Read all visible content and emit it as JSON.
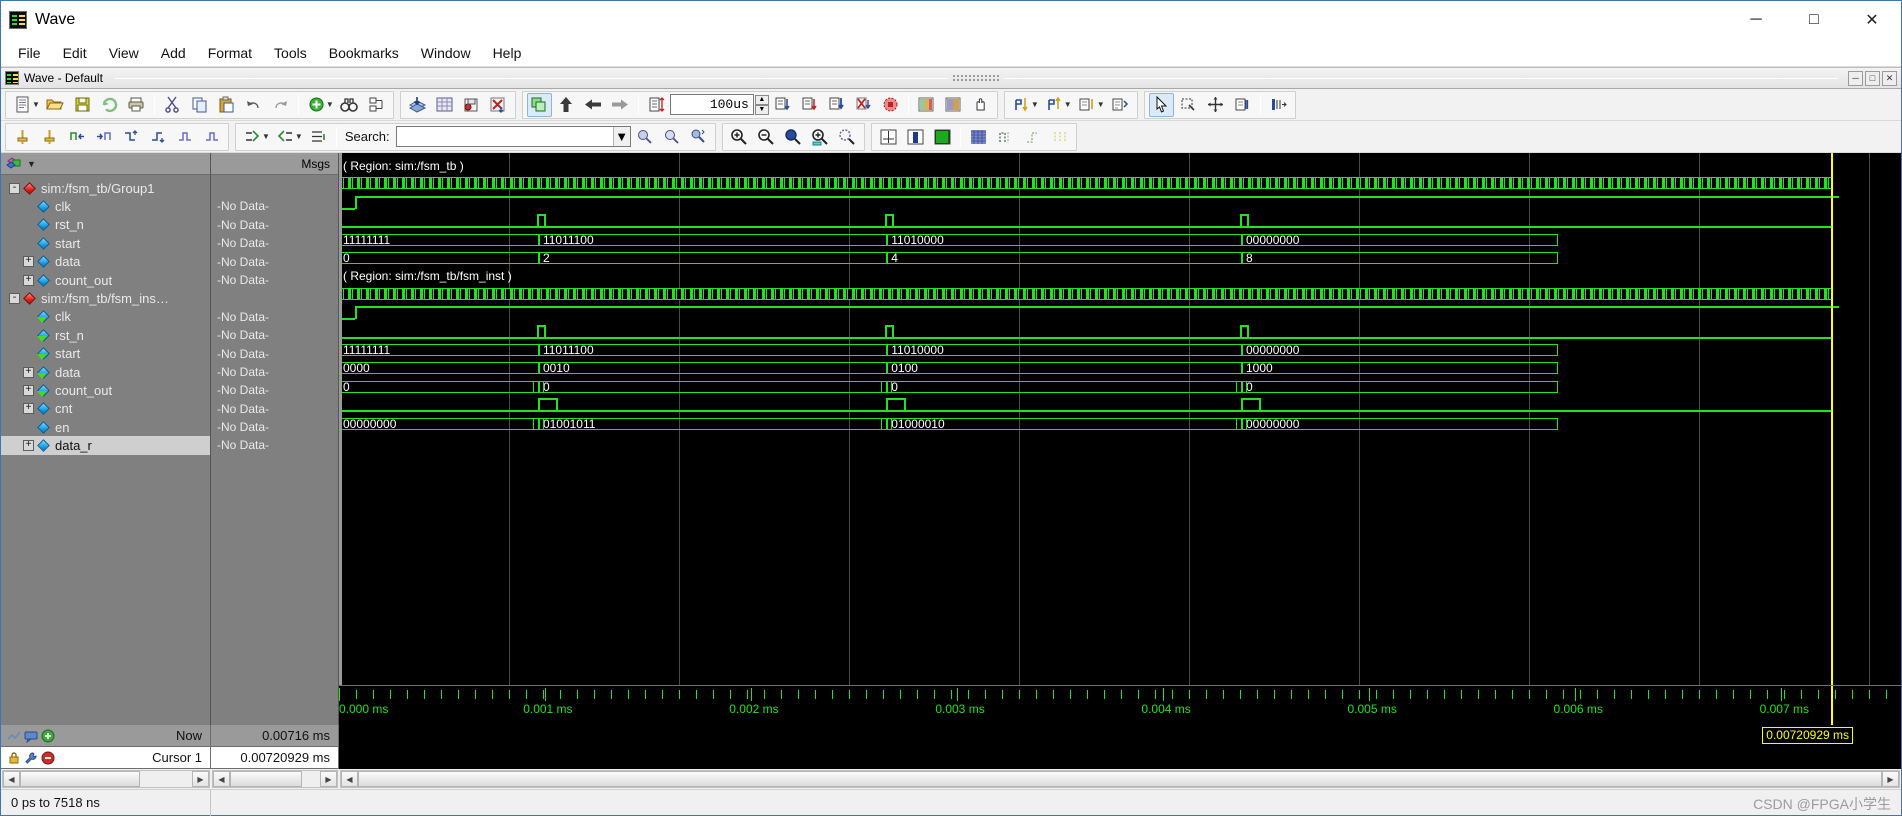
{
  "window": {
    "title": "Wave",
    "icon": "wave-app-icon",
    "minimize": "─",
    "maximize": "□",
    "close": "✕"
  },
  "menubar": {
    "items": [
      "File",
      "Edit",
      "View",
      "Add",
      "Format",
      "Tools",
      "Bookmarks",
      "Window",
      "Help"
    ]
  },
  "subwindow": {
    "title": "Wave - Default",
    "buttons": [
      "─",
      "□",
      "✕"
    ]
  },
  "toolbar": {
    "time_step_value": "100us",
    "search_label": "Search:",
    "search_value": "",
    "search_placeholder": ""
  },
  "panes": {
    "names_header_icon": "objects-icon",
    "values_header": "Msgs"
  },
  "signals": [
    {
      "name": "sim:/fsm_tb/Group1",
      "value": "",
      "indent": 0,
      "expander": "-",
      "icon": "red-diamond-icon",
      "type": "group"
    },
    {
      "name": "clk",
      "value": "-No Data-",
      "indent": 1,
      "expander": "",
      "icon": "blue-diamond-icon",
      "type": "signal"
    },
    {
      "name": "rst_n",
      "value": "-No Data-",
      "indent": 1,
      "expander": "",
      "icon": "blue-diamond-icon",
      "type": "signal"
    },
    {
      "name": "start",
      "value": "-No Data-",
      "indent": 1,
      "expander": "",
      "icon": "blue-diamond-icon",
      "type": "signal"
    },
    {
      "name": "data",
      "value": "-No Data-",
      "indent": 1,
      "expander": "+",
      "icon": "blue-diamond-icon",
      "type": "bus"
    },
    {
      "name": "count_out",
      "value": "-No Data-",
      "indent": 1,
      "expander": "+",
      "icon": "blue-diamond-icon",
      "type": "bus"
    },
    {
      "name": "sim:/fsm_tb/fsm_ins…",
      "value": "",
      "indent": 0,
      "expander": "-",
      "icon": "red-diamond-icon",
      "type": "group"
    },
    {
      "name": "clk",
      "value": "-No Data-",
      "indent": 1,
      "expander": "",
      "icon": "green-arrow-diamond-icon",
      "type": "signal"
    },
    {
      "name": "rst_n",
      "value": "-No Data-",
      "indent": 1,
      "expander": "",
      "icon": "green-arrow-diamond-icon",
      "type": "signal"
    },
    {
      "name": "start",
      "value": "-No Data-",
      "indent": 1,
      "expander": "",
      "icon": "green-arrow-diamond-icon",
      "type": "signal"
    },
    {
      "name": "data",
      "value": "-No Data-",
      "indent": 1,
      "expander": "+",
      "icon": "green-arrow-diamond-icon",
      "type": "bus"
    },
    {
      "name": "count_out",
      "value": "-No Data-",
      "indent": 1,
      "expander": "+",
      "icon": "green-arrow-diamond-icon",
      "type": "bus"
    },
    {
      "name": "cnt",
      "value": "-No Data-",
      "indent": 1,
      "expander": "+",
      "icon": "blue-diamond-icon",
      "type": "bus"
    },
    {
      "name": "en",
      "value": "-No Data-",
      "indent": 1,
      "expander": "",
      "icon": "blue-diamond-icon",
      "type": "signal"
    },
    {
      "name": "data_r",
      "value": "-No Data-",
      "indent": 1,
      "expander": "+",
      "icon": "blue-diamond-icon",
      "type": "bus"
    }
  ],
  "wave": {
    "regions": [
      {
        "label": "( Region: sim:/fsm_tb )",
        "row": 0
      },
      {
        "label": "( Region: sim:/fsm_tb/fsm_inst )",
        "row": 6
      }
    ],
    "bus_transitions": [
      {
        "row": 4,
        "values": [
          "11111111",
          "11011100",
          "11010000",
          "00000000"
        ]
      },
      {
        "row": 5,
        "values": [
          "0",
          "2",
          "4",
          "8"
        ]
      },
      {
        "row": 10,
        "values": [
          "11111111",
          "11011100",
          "11010000",
          "00000000"
        ]
      },
      {
        "row": 11,
        "values": [
          "0000",
          "0010",
          "0100",
          "1000"
        ]
      },
      {
        "row": 12,
        "values": [
          "0",
          "0",
          "0",
          "0"
        ]
      },
      {
        "row": 14,
        "values": [
          "00000000",
          "01001011",
          "01000010",
          "00000000"
        ]
      }
    ]
  },
  "timeline": {
    "unit": "ms",
    "ticks": [
      "0.000 ms",
      "0.001 ms",
      "0.002 ms",
      "0.003 ms",
      "0.004 ms",
      "0.005 ms",
      "0.006 ms",
      "0.007 ms"
    ],
    "tick_values": [
      0.0,
      0.001,
      0.002,
      0.003,
      0.004,
      0.005,
      0.006,
      0.007
    ]
  },
  "cursors": {
    "now_label": "Now",
    "now_value": "0.00716 ms",
    "cursor1_label": "Cursor 1",
    "cursor1_value": "0.00720929 ms",
    "cursor_flag": "0.00720929 ms",
    "cursor_color": "#ffff00"
  },
  "statusbar": {
    "range": "0 ps to 7518 ns",
    "watermark": "CSDN @FPGA小学生"
  },
  "colors": {
    "wave_green": "#23e223",
    "wave_bg": "#000000",
    "pane_bg": "#808080",
    "cursor": "#ffff00",
    "title_blue": "#3a76b8"
  }
}
